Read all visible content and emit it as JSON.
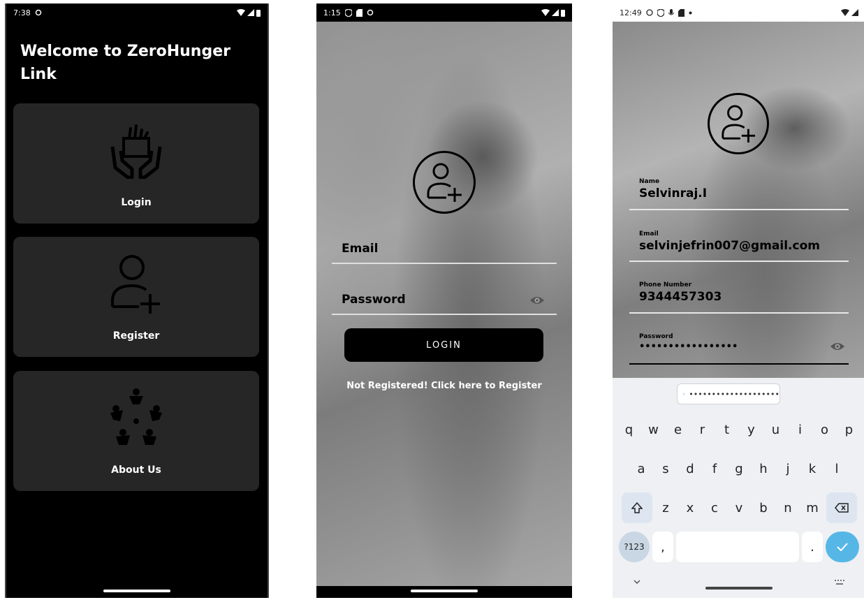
{
  "screen1": {
    "status_time": "7:38",
    "title": "Welcome to ZeroHunger Link",
    "cards": [
      {
        "label": "Login",
        "icon": "donation-hands-icon"
      },
      {
        "label": "Register",
        "icon": "add-user-icon"
      },
      {
        "label": "About Us",
        "icon": "community-people-icon"
      }
    ]
  },
  "screen2": {
    "status_time": "1:15",
    "email_label": "Email",
    "password_label": "Password",
    "login_button": "LOGIN",
    "register_link": "Not Registered! Click here to Register"
  },
  "screen3": {
    "status_time": "12:49",
    "fields": {
      "name_label": "Name",
      "name_value": "Selvinraj.I",
      "email_label": "Email",
      "email_value": "selvinjefrin007@gmail.com",
      "phone_label": "Phone Number",
      "phone_value": "9344457303",
      "password_label": "Password",
      "password_value": "•••••••••••••••••"
    },
    "clipboard_suggestion": "••••••••••••••••••••",
    "keyboard": {
      "row1": [
        "q",
        "w",
        "e",
        "r",
        "t",
        "y",
        "u",
        "i",
        "o",
        "p"
      ],
      "row2": [
        "a",
        "s",
        "d",
        "f",
        "g",
        "h",
        "j",
        "k",
        "l"
      ],
      "row3": [
        "z",
        "x",
        "c",
        "v",
        "b",
        "n",
        "m"
      ],
      "num_key": "?123",
      "comma_key": ",",
      "dot_key": "."
    }
  },
  "colors": {
    "card_bg": "#262626",
    "keyboard_bg": "#eef0f3",
    "enter_key": "#56b7e6"
  }
}
